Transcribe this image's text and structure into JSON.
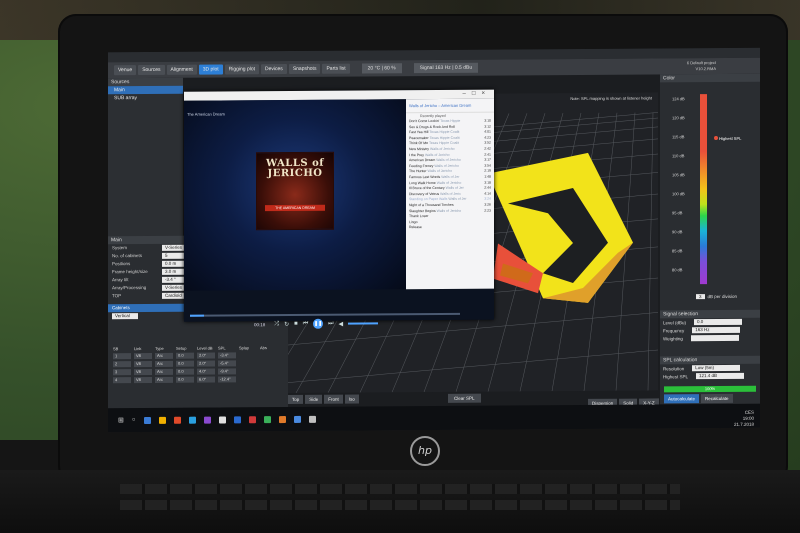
{
  "app": {
    "tabs": [
      "Venue",
      "Sources",
      "Alignment",
      "3D plot",
      "Rigging plot",
      "Devices",
      "Snapshots",
      "Parts list"
    ],
    "active_tab": "3D plot",
    "signal": "20 °C | 60 %",
    "signal_box": "Signal 163 Hz | 0.5 dBu",
    "project": "6 Default project",
    "version": "V10.2.RMA"
  },
  "left_panel": {
    "header": "Sources",
    "items": [
      "Main",
      "SUB array"
    ]
  },
  "main_panel": {
    "header": "Main",
    "rows": [
      {
        "label": "System",
        "value": "V-Series"
      },
      {
        "label": "No. of cabinets",
        "value": "5"
      },
      {
        "label": "Positions",
        "value": "0.0 m"
      },
      {
        "label": "Frame height/size",
        "value": "3.0 m"
      },
      {
        "label": "Array tilt",
        "value": "-3.4 °"
      },
      {
        "label": "Array/Processing",
        "value": "V-Series"
      },
      {
        "label": "TOP",
        "value": "Cardioid"
      }
    ],
    "cabinets_header": "Cabinets",
    "mode": "Vertical",
    "cab_columns": [
      "SB",
      "Link",
      "Type",
      "Setup",
      "Level dB",
      "SPL",
      "Splay",
      "Abs"
    ],
    "cab_rows": [
      [
        "1",
        "V8",
        "Arc",
        "0.0",
        "2.0°",
        "-3.4°"
      ],
      [
        "2",
        "V8",
        "Arc",
        "0.0",
        "2.0°",
        "-5.4°"
      ],
      [
        "3",
        "V8",
        "Arc",
        "0.0",
        "4.0°",
        "-9.4°"
      ],
      [
        "4",
        "V8",
        "Arc",
        "0.0",
        "6.0°",
        "-12.4°"
      ]
    ]
  },
  "view": {
    "note": "Note: SPL mapping is shown at listener height",
    "buttons": [
      "Top",
      "Side",
      "Front",
      "Iso"
    ],
    "clear": "Clear SPL",
    "right_buttons": [
      "Dispersion",
      "Solid",
      "X-Y-Z"
    ]
  },
  "right_panel": {
    "header": "Color",
    "scale_labels": [
      "124 dB",
      "120 dB",
      "115 dB",
      "110 dB",
      "105 dB",
      "100 dB",
      "95 dB",
      "90 dB",
      "85 dB",
      "80 dB"
    ],
    "highest_label": "Highest SPL",
    "db_per_division": "3",
    "db_unit": "dB per division",
    "signal_selection": "Signal selection",
    "level": {
      "label": "Level (dBu)",
      "value": "0.0"
    },
    "frequency": {
      "label": "Frequency",
      "value": "163 Hz"
    },
    "weighting": {
      "label": "Weighting",
      "value": ""
    },
    "spl_calc": "SPL calculation",
    "resolution": {
      "label": "Resolution",
      "value": "Low (5m)"
    },
    "highest_spl": {
      "label": "Highest SPL",
      "value": "121.4 dB"
    },
    "progress_label": "100%",
    "progress": 1.0,
    "btn_auto": "Autocalculate",
    "btn_recalc": "Recalculate"
  },
  "player": {
    "window_title": "The American Dream",
    "album_artist": "WALLS of JERICHO",
    "album_title": "THE AMERICAN DREAM",
    "time": "00:18",
    "progress": 0.05,
    "playlist_header": "Walls of Jericho – American Dream",
    "playlist_sub": "Recently played",
    "tracks": [
      {
        "title": "Don't Come Lookin'",
        "artist": "Texas Hippie",
        "dur": "3:10"
      },
      {
        "title": "Sex & Drugs & Rock And Roll",
        "artist": "",
        "dur": "3:12"
      },
      {
        "title": "Fast Yea Hill",
        "artist": "Texas Hippie Coalit",
        "dur": "4:01"
      },
      {
        "title": "Peacemaker",
        "artist": "Texas Hippie Coalit",
        "dur": "4:23"
      },
      {
        "title": "Think Of Me",
        "artist": "Texas Hippie Coalit",
        "dur": "3:52"
      },
      {
        "title": "New Ministry",
        "artist": "Walls of Jericho",
        "dur": "2:42"
      },
      {
        "title": "I the Prey",
        "artist": "Walls of Jericho",
        "dur": "2:41"
      },
      {
        "title": "American Dream",
        "artist": "Walls of Jericho",
        "dur": "3:17"
      },
      {
        "title": "Feeding Frenzy",
        "artist": "Walls of Jericho",
        "dur": "3:54"
      },
      {
        "title": "The Hunter",
        "artist": "Walls of Jericho",
        "dur": "2:19"
      },
      {
        "title": "Famous Last Words",
        "artist": "Walls of Jer",
        "dur": "1:48"
      },
      {
        "title": "Long Walk Home",
        "artist": "Walls of Jericho",
        "dur": "3:18"
      },
      {
        "title": "Ill Bruce of the Century",
        "artist": "Walls of Jer",
        "dur": "2:44"
      },
      {
        "title": "Discovery of Vetrus",
        "artist": "Walls of Jeric",
        "dur": "4:14"
      },
      {
        "title": "Standing on Paper Walls",
        "artist": "Walls of Jer",
        "dur": "3:24"
      },
      {
        "title": "Night of a Thousand Torches",
        "artist": "",
        "dur": "3:26"
      },
      {
        "title": "Slaughter Begins",
        "artist": "Walls of Jericho",
        "dur": "2:23"
      },
      {
        "title": "Thank Loser",
        "artist": "",
        "dur": ""
      },
      {
        "title": "Lingo",
        "artist": "",
        "dur": ""
      },
      {
        "title": "Release",
        "artist": "",
        "dur": ""
      }
    ]
  },
  "taskbar": {
    "clock": "19:00",
    "date": "21.7.2018",
    "lang": "CES"
  },
  "colors": {
    "accent": "#2f6fb8",
    "spl_hot": "#f5e21a",
    "spl_red": "#e8503a"
  }
}
